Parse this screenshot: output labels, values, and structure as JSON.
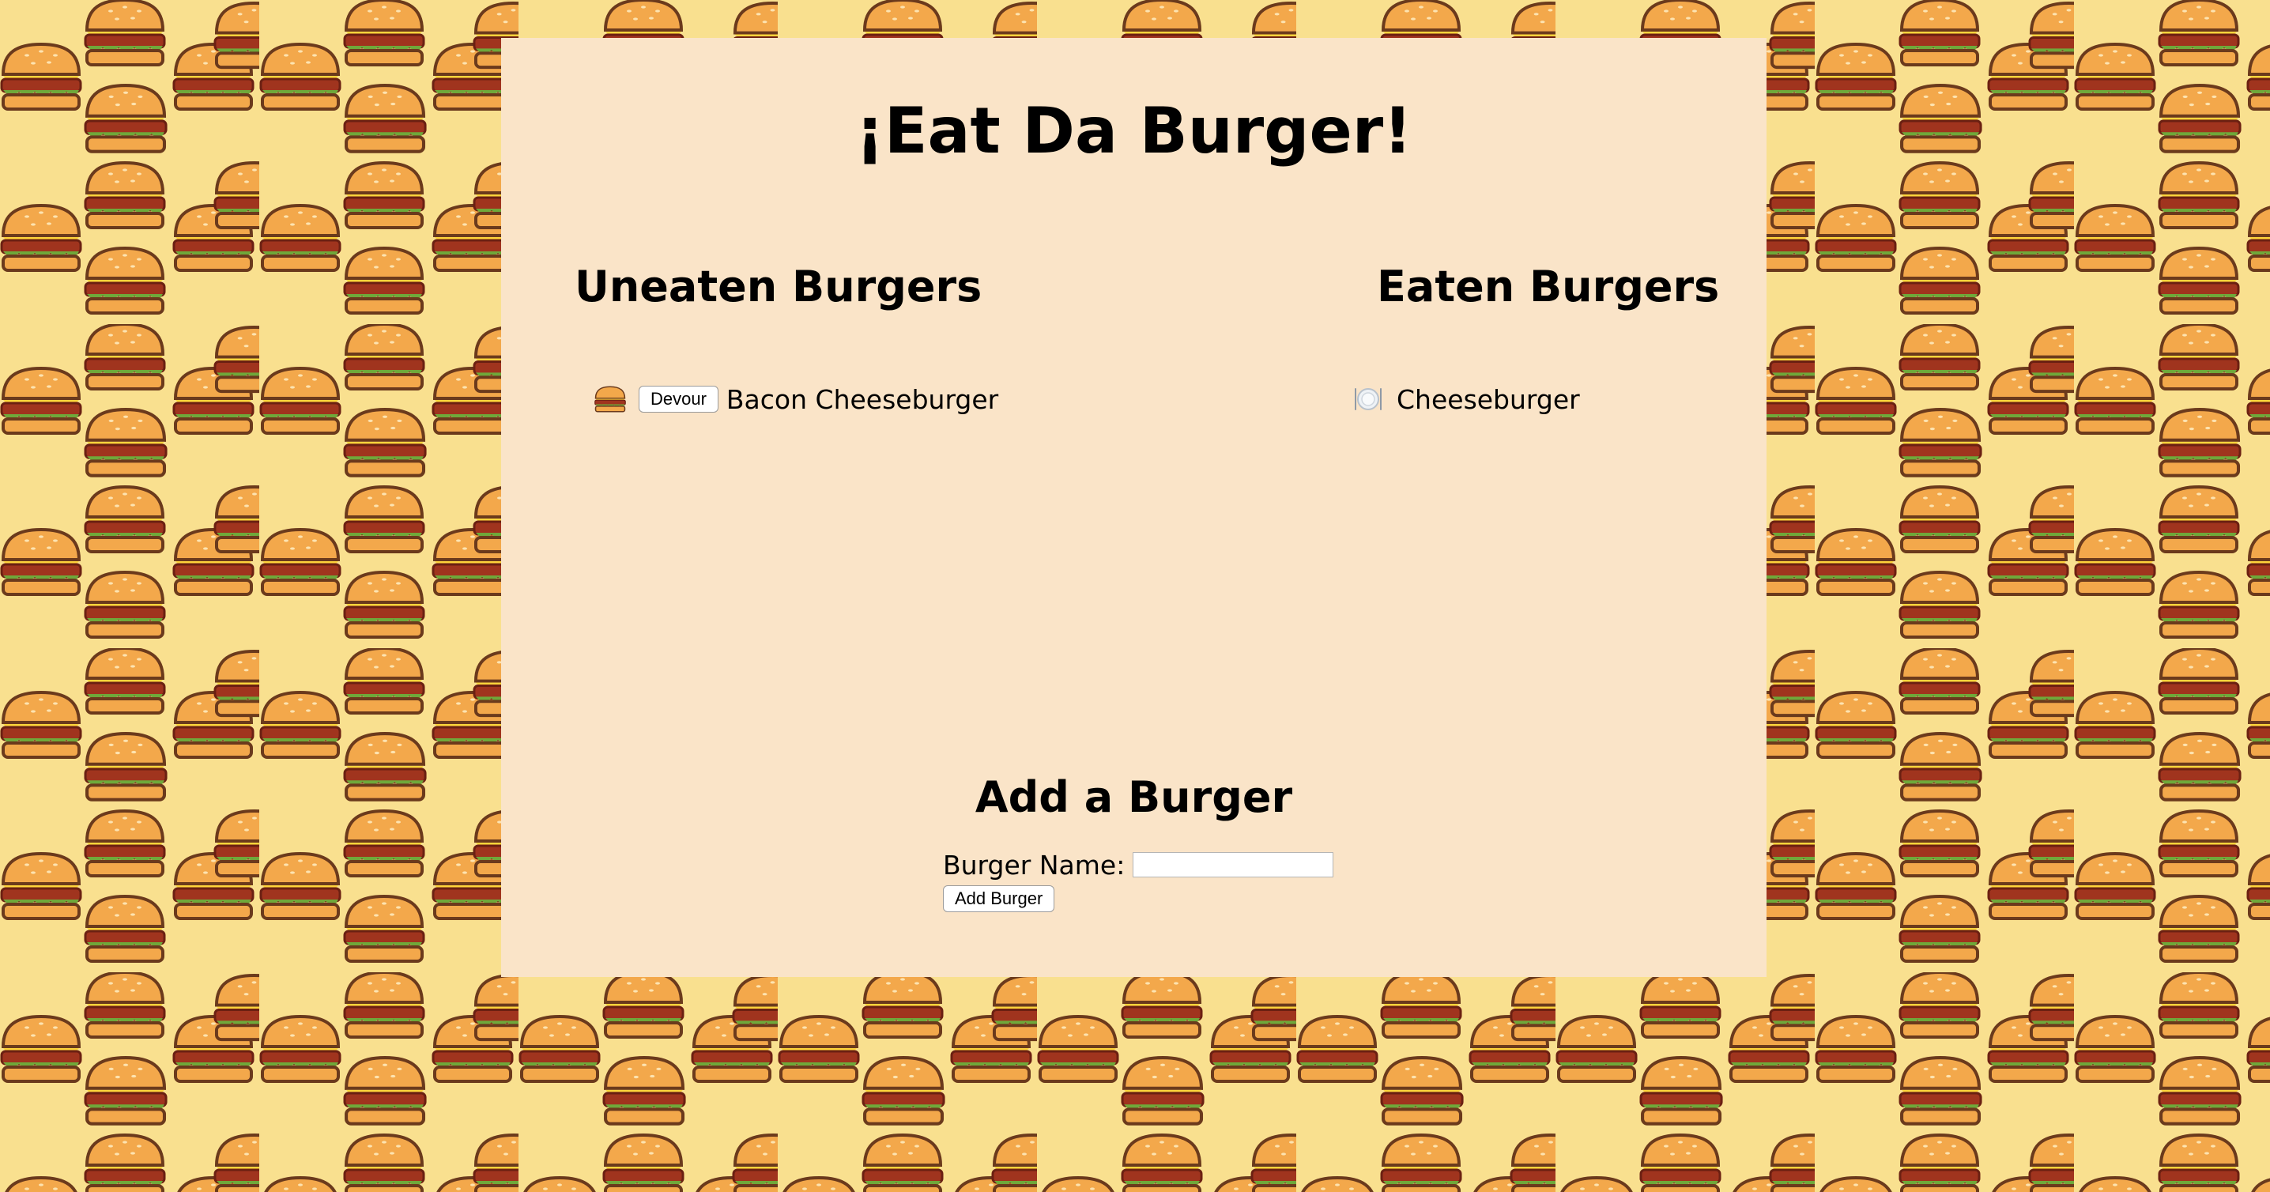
{
  "page": {
    "title": "¡Eat Da Burger!",
    "background_color": "#f9e08f",
    "panel_color": "#fae4c8",
    "background_pattern_icon": "hamburger-icon"
  },
  "uneaten": {
    "heading": "Uneaten Burgers",
    "items": [
      {
        "icon": "hamburger-icon",
        "button_label": "Devour",
        "name": "Bacon Cheeseburger"
      }
    ]
  },
  "eaten": {
    "heading": "Eaten Burgers",
    "items": [
      {
        "icon": "plate-icon",
        "name": "Cheeseburger"
      }
    ]
  },
  "add_form": {
    "heading": "Add a Burger",
    "field_label": "Burger Name:",
    "field_value": "",
    "submit_label": "Add Burger"
  }
}
